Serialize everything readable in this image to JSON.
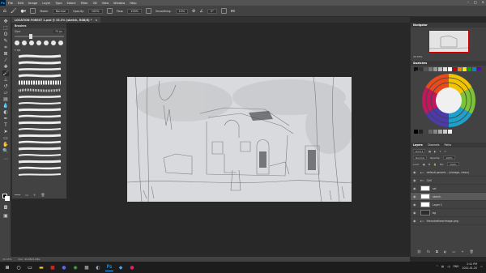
{
  "app": {
    "logo": "Ps"
  },
  "menu": [
    "File",
    "Edit",
    "Image",
    "Layer",
    "Type",
    "Select",
    "Filter",
    "3D",
    "View",
    "Window",
    "Help"
  ],
  "options": {
    "mode_label": "Mode:",
    "mode": "Normal",
    "opacity_label": "Opacity:",
    "opacity": "100%",
    "flow_label": "Flow:",
    "flow": "100%",
    "smoothing_label": "Smoothing:",
    "smoothing": "10%",
    "angle": "0°"
  },
  "document": {
    "tab_title": "LOCATION FOREST 1.psd @ 33.3% (sketch, RGB/8) *"
  },
  "brushes": {
    "title": "Brushes",
    "size_label": "Size:",
    "size_value": "75 px",
    "folder": "TJB"
  },
  "navigator": {
    "title": "Navigator",
    "zoom": "33.33%"
  },
  "swatches": {
    "title": "Swatches"
  },
  "layers": {
    "tabs": [
      "Layers",
      "Channels",
      "Paths"
    ],
    "kind_label": "Kind",
    "blend": "Normal",
    "opacity_label": "Opacity:",
    "opacity": "100%",
    "lock_label": "Lock:",
    "fill_label": "Fill:",
    "fill": "100%",
    "rows": [
      {
        "name": "default generic - (vintage, clean)",
        "type": "folder"
      },
      {
        "name": "Cell",
        "type": "folder"
      },
      {
        "name": "sel",
        "type": "layer"
      },
      {
        "name": "sketch",
        "type": "layer"
      },
      {
        "name": "Layer 1",
        "type": "layer"
      },
      {
        "name": "bg",
        "type": "layer"
      },
      {
        "name": "thevoicetheorimage.png",
        "type": "folder"
      }
    ]
  },
  "status": {
    "zoom": "33.33%",
    "doc": "Doc: 99.6M/1.08G"
  },
  "taskbar": {
    "lang": "ENG",
    "time": "2:41 PM",
    "date": "2022-01-20"
  },
  "colors": {
    "accent": "#31a8ff",
    "panel": "#424242",
    "workspace": "#282828"
  }
}
